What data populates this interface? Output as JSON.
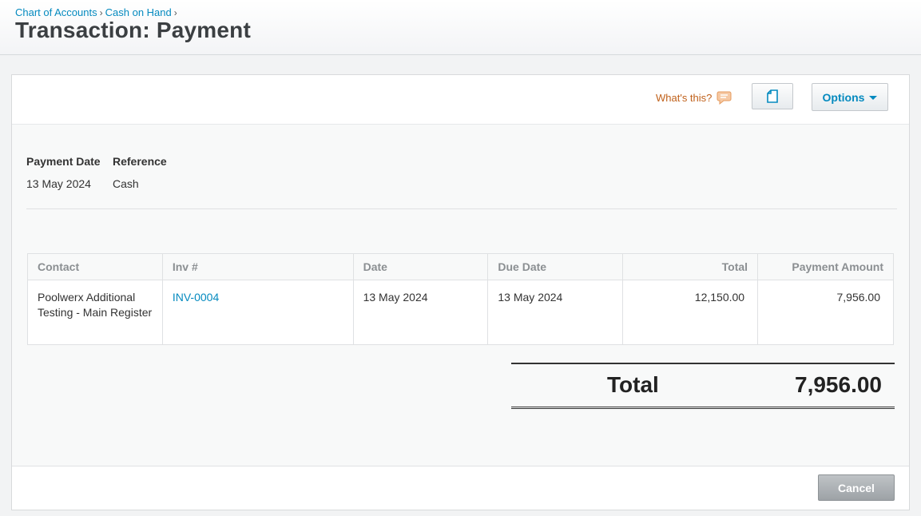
{
  "breadcrumb": {
    "items": [
      "Chart of Accounts",
      "Cash on Hand"
    ],
    "separator": "›"
  },
  "page": {
    "title": "Transaction: Payment"
  },
  "toolbar": {
    "whats_this": "What's this?",
    "options_label": "Options",
    "icons": {
      "help": "speech-bubble-icon",
      "copy": "document-icon",
      "caret": "caret-down-icon"
    }
  },
  "meta": {
    "payment_date_label": "Payment Date",
    "payment_date_value": "13 May 2024",
    "reference_label": "Reference",
    "reference_value": "Cash"
  },
  "table": {
    "headers": [
      "Contact",
      "Inv #",
      "Date",
      "Due Date",
      "Total",
      "Payment Amount"
    ],
    "rows": [
      {
        "contact": "Poolwerx Additional Testing - Main Register",
        "invoice": "INV-0004",
        "date": "13 May 2024",
        "due_date": "13 May 2024",
        "total": "12,150.00",
        "payment_amount": "7,956.00"
      }
    ]
  },
  "summary": {
    "total_label": "Total",
    "total_value": "7,956.00"
  },
  "footer": {
    "cancel_label": "Cancel"
  },
  "colors": {
    "link": "#048abf",
    "accent_orange": "#c0611b",
    "title": "#3b3f42"
  }
}
